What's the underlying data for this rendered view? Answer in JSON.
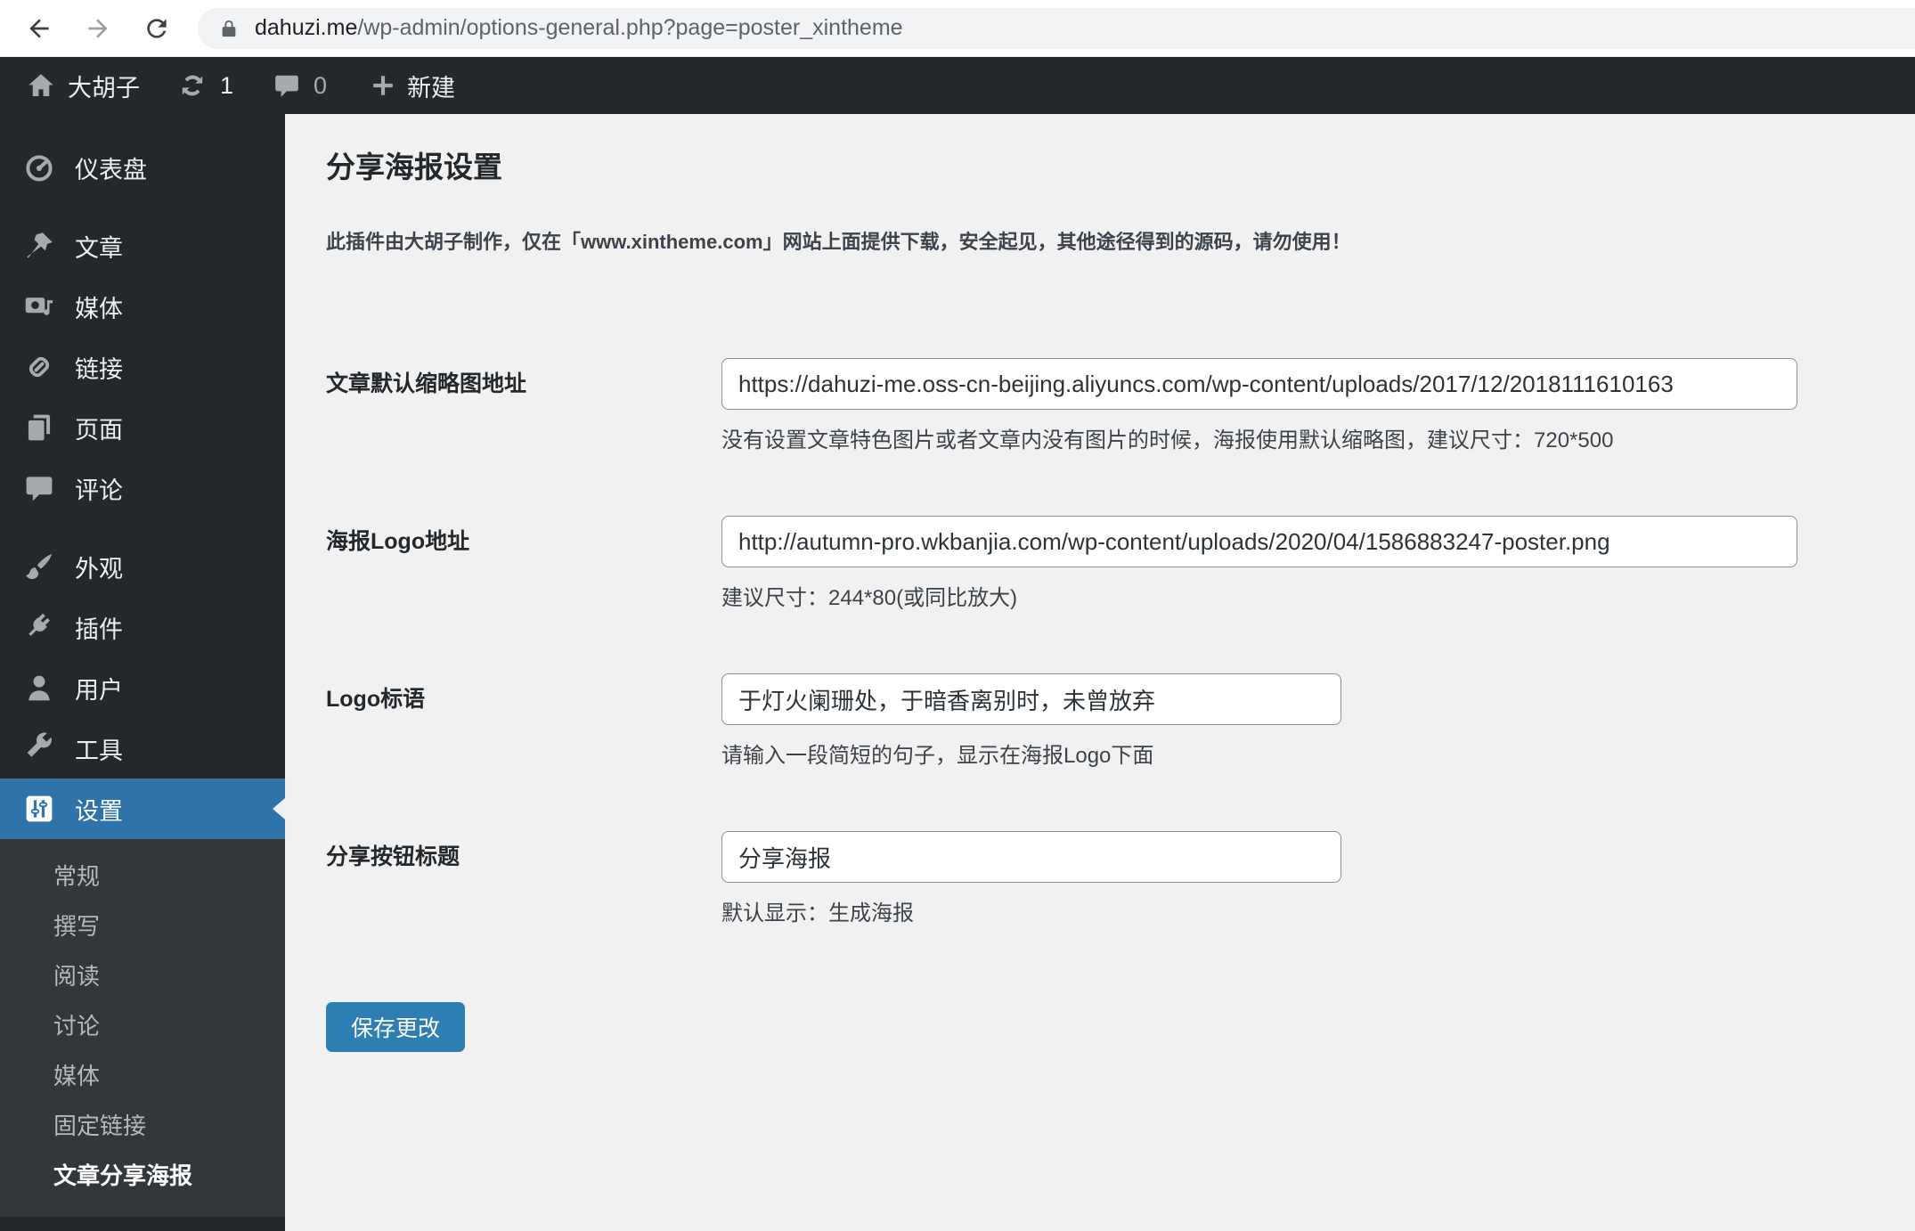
{
  "browser": {
    "url_host": "dahuzi.me",
    "url_path": "/wp-admin/options-general.php?page=poster_xintheme"
  },
  "admin_bar": {
    "site_name": "大胡子",
    "update_count": "1",
    "comment_count": "0",
    "new_label": "新建"
  },
  "sidebar": {
    "items": [
      {
        "label": "仪表盘",
        "icon": "dashboard-icon"
      },
      {
        "label": "文章",
        "icon": "pin-icon"
      },
      {
        "label": "媒体",
        "icon": "media-icon"
      },
      {
        "label": "链接",
        "icon": "link-icon"
      },
      {
        "label": "页面",
        "icon": "pages-icon"
      },
      {
        "label": "评论",
        "icon": "comments-icon"
      },
      {
        "label": "外观",
        "icon": "appearance-icon"
      },
      {
        "label": "插件",
        "icon": "plugins-icon"
      },
      {
        "label": "用户",
        "icon": "users-icon"
      },
      {
        "label": "工具",
        "icon": "tools-icon"
      },
      {
        "label": "设置",
        "icon": "settings-icon",
        "active": true
      }
    ],
    "submenu": {
      "items": [
        "常规",
        "撰写",
        "阅读",
        "讨论",
        "媒体",
        "固定链接",
        "文章分享海报"
      ],
      "current": "文章分享海报"
    }
  },
  "main": {
    "title": "分享海报设置",
    "notice": "此插件由大胡子制作，仅在「www.xintheme.com」网站上面提供下载，安全起见，其他途径得到的源码，请勿使用！",
    "fields": [
      {
        "label": "文章默认缩略图地址",
        "value": "https://dahuzi-me.oss-cn-beijing.aliyuncs.com/wp-content/uploads/2017/12/2018111610163",
        "help": "没有设置文章特色图片或者文章内没有图片的时候，海报使用默认缩略图，建议尺寸：720*500"
      },
      {
        "label": "海报Logo地址",
        "value": "http://autumn-pro.wkbanjia.com/wp-content/uploads/2020/04/1586883247-poster.png",
        "help": "建议尺寸：244*80(或同比放大)"
      },
      {
        "label": "Logo标语",
        "value": "于灯火阑珊处，于暗香离别时，未曾放弃",
        "help": "请输入一段简短的句子，显示在海报Logo下面"
      },
      {
        "label": "分享按钮标题",
        "value": "分享海报",
        "help": "默认显示：生成海报"
      }
    ],
    "save_label": "保存更改"
  },
  "colors": {
    "accent_blue": "#2e73aa",
    "button_blue": "#2d7eb3",
    "admin_dark": "#23282d",
    "submenu_dark": "#32373c",
    "content_bg": "#f1f1f1"
  }
}
